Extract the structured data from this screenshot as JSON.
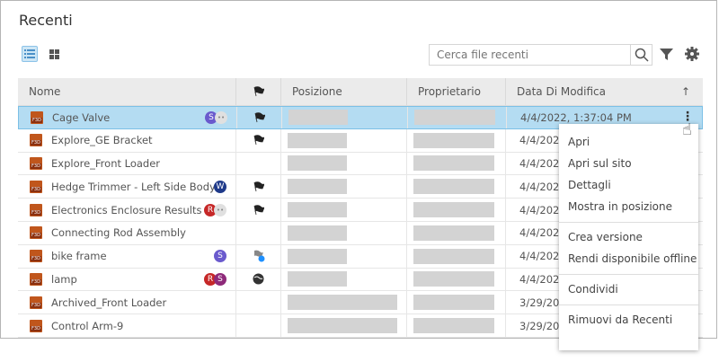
{
  "title": "Recenti",
  "search": {
    "placeholder": "Cerca file recenti"
  },
  "columns": {
    "name": "Nome",
    "position": "Posizione",
    "owner": "Proprietario",
    "date": "Data Di Modifica"
  },
  "rows": [
    {
      "name": "Cage Valve",
      "date": "4/4/2022, 1:37:04 PM",
      "avatars": [
        {
          "l": "S",
          "c": "#6a5acd"
        }
      ],
      "more": true,
      "flag": "flag"
    },
    {
      "name": "Explore_GE Bracket",
      "date": "4/4/2022",
      "avatars": [],
      "flag": "flag"
    },
    {
      "name": "Explore_Front Loader",
      "date": "4/4/2022",
      "avatars": [],
      "flag": ""
    },
    {
      "name": "Hedge Trimmer - Left Side Body",
      "date": "4/4/2022",
      "avatars": [
        {
          "l": "W",
          "c": "#1f3a8a"
        }
      ],
      "flag": "flag"
    },
    {
      "name": "Electronics Enclosure Results v1",
      "date": "4/4/2022",
      "avatars": [
        {
          "l": "R",
          "c": "#c62828"
        }
      ],
      "more": true,
      "flag": "flag"
    },
    {
      "name": "Connecting Rod Assembly",
      "date": "4/4/2022",
      "avatars": [],
      "flag": ""
    },
    {
      "name": "bike frame",
      "date": "4/4/2022",
      "avatars": [
        {
          "l": "S",
          "c": "#6a5acd"
        }
      ],
      "flag": "flag-info"
    },
    {
      "name": "lamp",
      "date": "4/4/2022",
      "avatars": [
        {
          "l": "R",
          "c": "#c62828"
        },
        {
          "l": "S",
          "c": "#8e2a7a"
        }
      ],
      "flag": "globe"
    },
    {
      "name": "Archived_Front Loader",
      "date": "3/29/2022",
      "avatars": [],
      "flag": ""
    },
    {
      "name": "Control Arm-9",
      "date": "3/29/2022",
      "avatars": [],
      "flag": ""
    }
  ],
  "menu": {
    "open": "Apri",
    "open_site": "Apri sul sito",
    "details": "Dettagli",
    "show_position": "Mostra in posizione",
    "create_version": "Crea versione",
    "offline": "Rendi disponibile offline",
    "share": "Condividi",
    "remove": "Rimuovi da Recenti"
  }
}
